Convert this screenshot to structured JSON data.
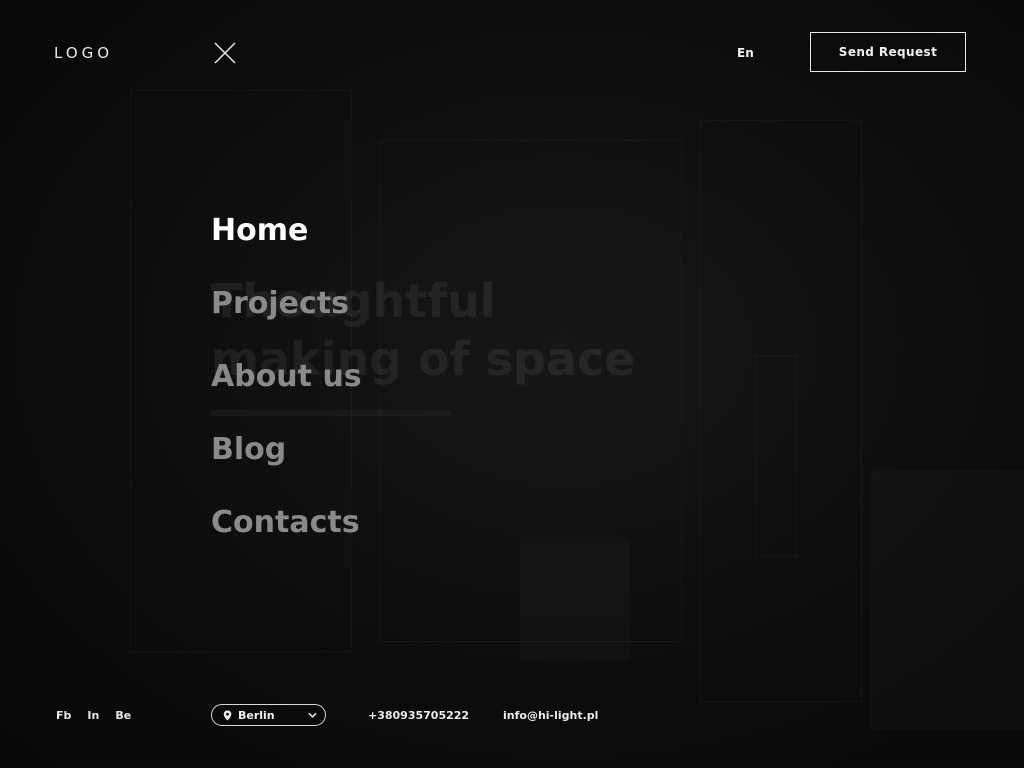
{
  "header": {
    "logo": "LOGO",
    "language": "En",
    "send_request": "Send Request",
    "close_icon": "close-icon"
  },
  "background": {
    "headline_line1": "Thoughtful",
    "headline_line2": "making of space"
  },
  "menu": {
    "items": [
      {
        "label": "Home",
        "active": true
      },
      {
        "label": "Projects",
        "active": false
      },
      {
        "label": "About us",
        "active": false
      },
      {
        "label": "Blog",
        "active": false
      },
      {
        "label": "Contacts",
        "active": false
      }
    ]
  },
  "footer": {
    "social": [
      "Fb",
      "In",
      "Be"
    ],
    "city": "Berlin",
    "city_icon": "location-pin-icon",
    "phone": "+380935705222",
    "email": "info@hi-light.pl"
  },
  "colors": {
    "background": "#0b0b0b",
    "active_menu": "#ffffff",
    "inactive_menu": "#8a8a8a"
  }
}
